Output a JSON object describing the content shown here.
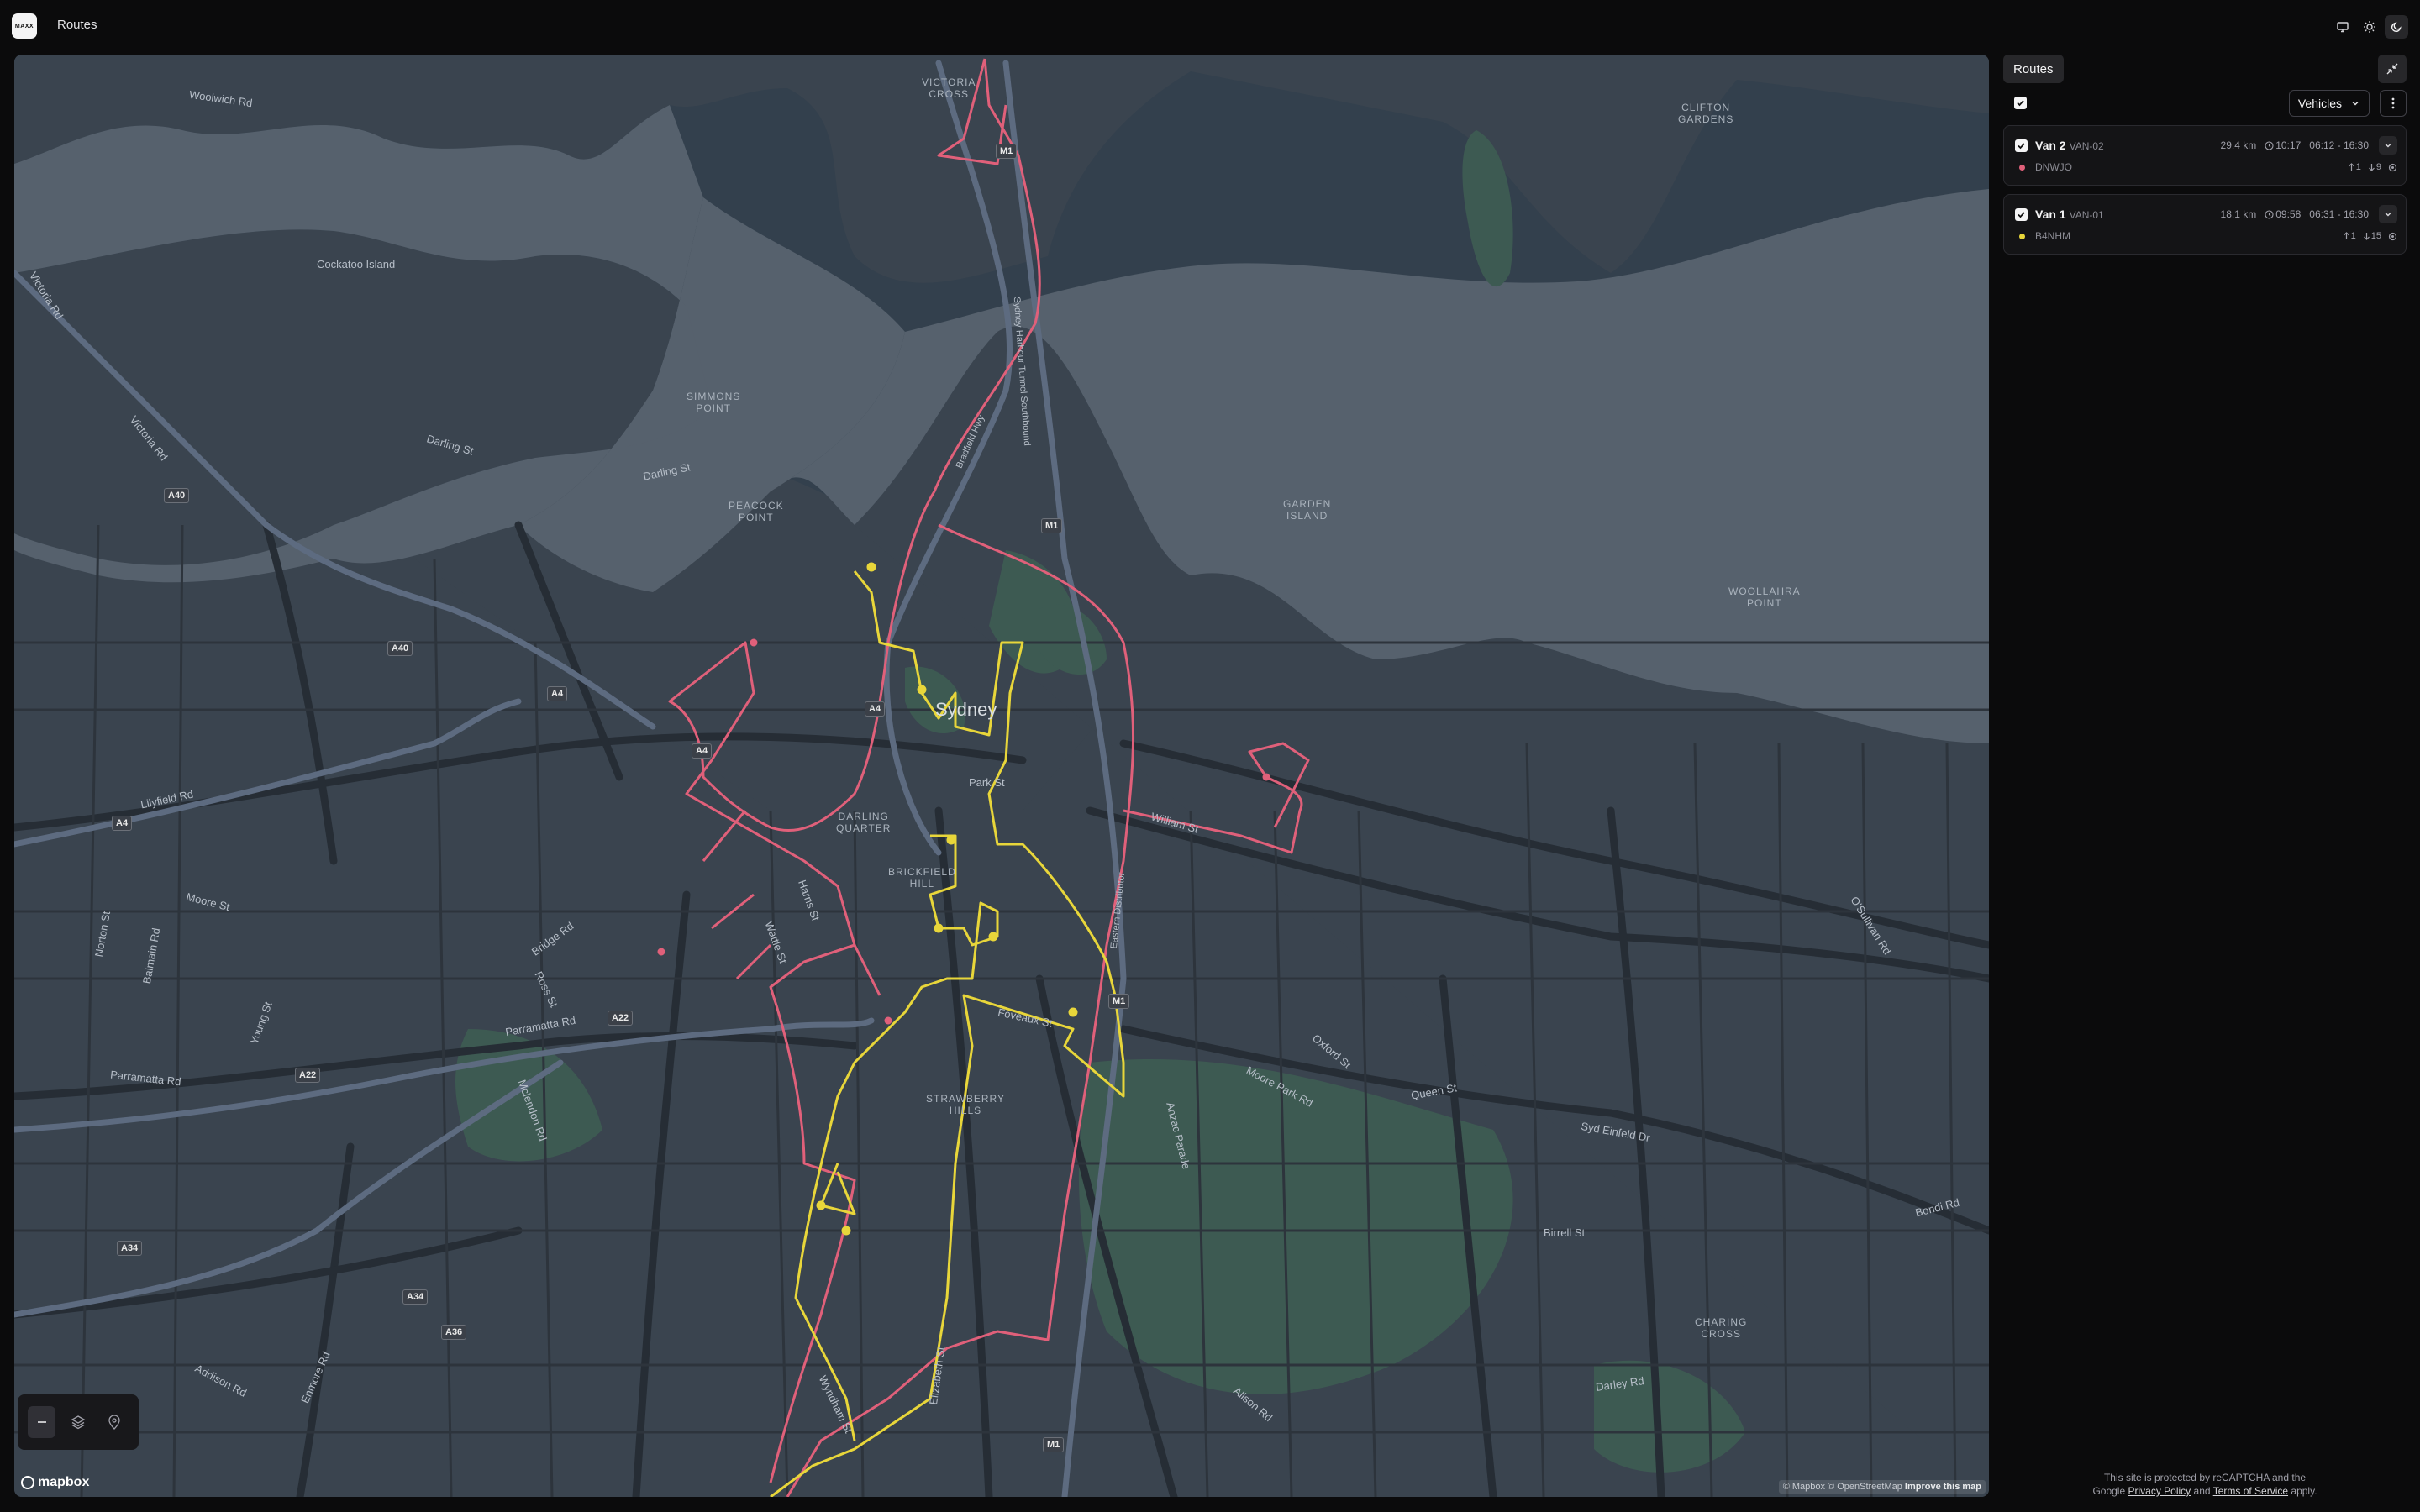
{
  "app": {
    "logo_text": "MAXX",
    "title": "Routes"
  },
  "theme": {
    "options": [
      "monitor-icon",
      "sun-icon",
      "moon-icon"
    ],
    "active": "moon-icon"
  },
  "panel": {
    "tab_label": "Routes",
    "vehicles_select": "Vehicles",
    "routes": [
      {
        "name": "Van 2",
        "code": "VAN-02",
        "distance": "29.4 km",
        "duration": "10:17",
        "window": "06:12 - 16:30",
        "plate": "DNWJO",
        "color": "#e0607a",
        "pickups": "1",
        "dropoffs": "9"
      },
      {
        "name": "Van 1",
        "code": "VAN-01",
        "distance": "18.1 km",
        "duration": "09:58",
        "window": "06:31 - 16:30",
        "plate": "B4NHM",
        "color": "#e8d63a",
        "pickups": "1",
        "dropoffs": "15"
      }
    ],
    "recaptcha": {
      "line1": "This site is protected by reCAPTCHA and the",
      "google": "Google",
      "privacy": "Privacy Policy",
      "and": "and",
      "terms": "Terms of Service",
      "apply": "apply."
    }
  },
  "map": {
    "attribution_1": "© Mapbox © OpenStreetMap",
    "attribution_2": "Improve this map",
    "mapbox_logo": "mapbox",
    "labels": {
      "victoria_cross": "VICTORIA\nCROSS",
      "clifton_gardens": "CLIFTON\nGARDENS",
      "woolwich_rd": "Woolwich Rd",
      "cockatoo_island": "Cockatoo Island",
      "simmons_point": "SIMMONS\nPOINT",
      "peacock_point": "PEACOCK\nPOINT",
      "garden_island": "GARDEN\nISLAND",
      "woolahra_point": "WOOLLAHRA\nPOINT",
      "darling_st_1": "Darling St",
      "darling_st_2": "Darling St",
      "victoria_rd_1": "Victoria Rd",
      "victoria_rd_2": "Victoria Rd",
      "sydney": "Sydney",
      "darling_quarter": "DARLING\nQUARTER",
      "brickfield_hill": "BRICKFIELD\nHILL",
      "strawberry_hills": "STRAWBERRY\nHILLS",
      "charing_cross": "CHARING\nCROSS",
      "park_st": "Park St",
      "william_st": "William St",
      "foveaux_st": "Foveaux St",
      "lilyfield_rd": "Lilyfield Rd",
      "moore_st": "Moore St",
      "bridge_rd": "Bridge Rd",
      "parramatta_rd_1": "Parramatta Rd",
      "parramatta_rd_2": "Parramatta Rd",
      "harris_st": "Harris St",
      "wattle_st": "Wattle St",
      "oxford_st": "Oxford St",
      "moore_park_rd": "Moore Park Rd",
      "queen_st": "Queen St",
      "syd_einfeld_dr": "Syd Einfeld Dr",
      "osullivan_rd": "O'Sullivan Rd",
      "birrell_st": "Birrell St",
      "bondi_rd": "Bondi Rd",
      "darley_rd": "Darley Rd",
      "alison_rd": "Alison Rd",
      "anzac_parade": "Anzac Parade",
      "elizabeth_st": "Elizabeth St",
      "wyndham_st": "Wyndham St",
      "addison_rd": "Addison Rd",
      "enmore_rd": "Enmore Rd",
      "young_st": "Young St",
      "norton_st": "Norton St",
      "balmain_rd": "Balmain Rd",
      "ross_st": "Ross St",
      "mclendon_rd": "Mclendon Rd",
      "sydney_harbour_tunnel": "Sydney Harbour Tunnel Southbound",
      "bradfield_hwy": "Bradfield Hwy",
      "eastern_distributor": "Eastern Distributor"
    },
    "shields": {
      "m1_top": "M1",
      "m1_mid": "M1",
      "m1_low": "M1",
      "m1_bottom": "M1",
      "a40_1": "A40",
      "a40_2": "A40",
      "a4_1": "A4",
      "a4_2": "A4",
      "a4_3": "A4",
      "a4_4": "A4",
      "a22_1": "A22",
      "a22_2": "A22",
      "a34_1": "A34",
      "a34_2": "A34",
      "a36": "A36"
    }
  }
}
